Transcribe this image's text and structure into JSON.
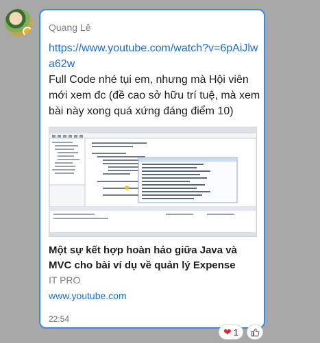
{
  "message": {
    "sender": "Quang Lê",
    "link": "https://www.youtube.com/watch?v=6pAiJlwa62w",
    "text": "Full Code nhé tụi em, nhưng mà Hội viên mới xem đc (đề cao sở hữu trí tuệ, mà xem bài này xong quá xứng đáng điểm 10)",
    "time": "22:54"
  },
  "preview": {
    "title": "Một sự kết hợp hoàn hảo giữa Java và MVC cho bài ví dụ về quản lý Expense",
    "source": "IT PRO",
    "domain": "www.youtube.com"
  },
  "reactions": {
    "heart_icon": "heart-icon",
    "heart_count": "1",
    "like_icon": "thumbs-up-icon"
  },
  "colors": {
    "bubble_border": "#2f8cf0",
    "link": "#1a6dd6",
    "background": "#a8a8a8"
  }
}
